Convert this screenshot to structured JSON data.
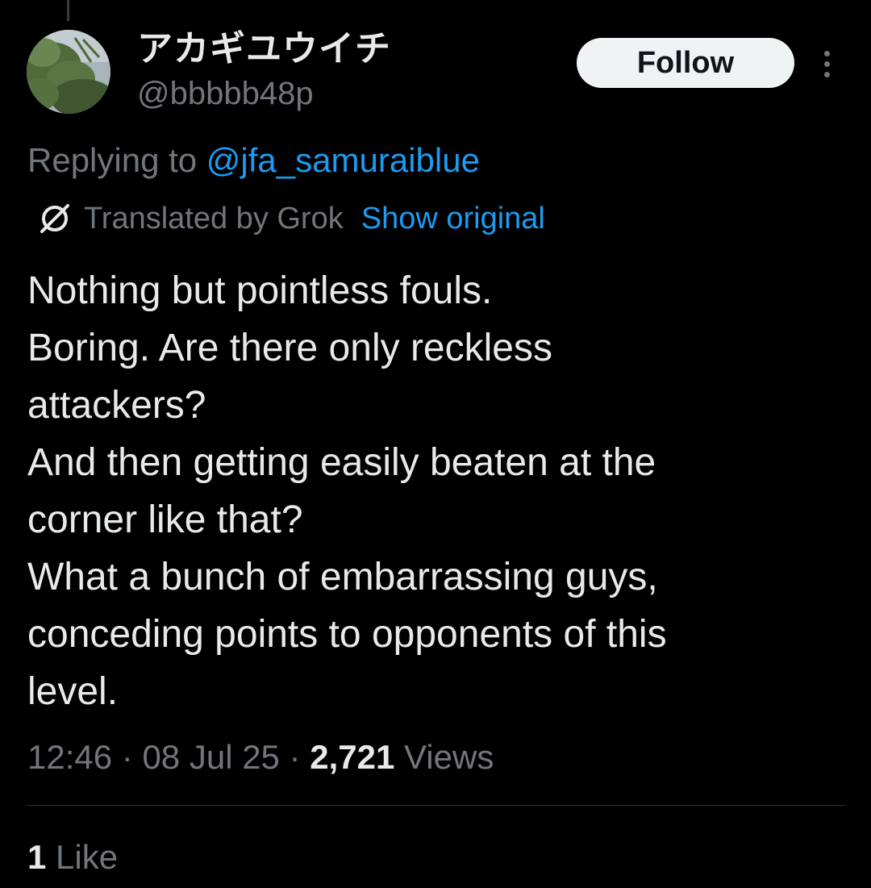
{
  "author": {
    "display_name": "アカギユウイチ",
    "handle": "@bbbbb48p",
    "avatar_icon": "avatar-tree-photo"
  },
  "follow_label": "Follow",
  "more_icon": "more-vertical-icon",
  "reply": {
    "prefix": "Replying to ",
    "target": "@jfa_samuraiblue"
  },
  "translation": {
    "icon": "grok-icon",
    "label": "Translated by Grok",
    "show_original": "Show original"
  },
  "tweet_lines": [
    "Nothing but pointless fouls.",
    "Boring. Are there only reckless",
    "attackers?",
    "And then getting easily beaten at the",
    "corner like that?",
    "What a bunch of embarrassing guys,",
    "conceding points to opponents of this",
    "level."
  ],
  "meta": {
    "time": "12:46",
    "date": "08 Jul 25",
    "views_count": "2,721",
    "views_label": "Views",
    "separator": "·"
  },
  "likes": {
    "count": "1",
    "label": "Like"
  },
  "colors": {
    "background": "#000000",
    "text_primary": "#e7e9ea",
    "text_secondary": "#71767b",
    "link": "#1d9bf0",
    "button_bg": "#eff3f4"
  }
}
